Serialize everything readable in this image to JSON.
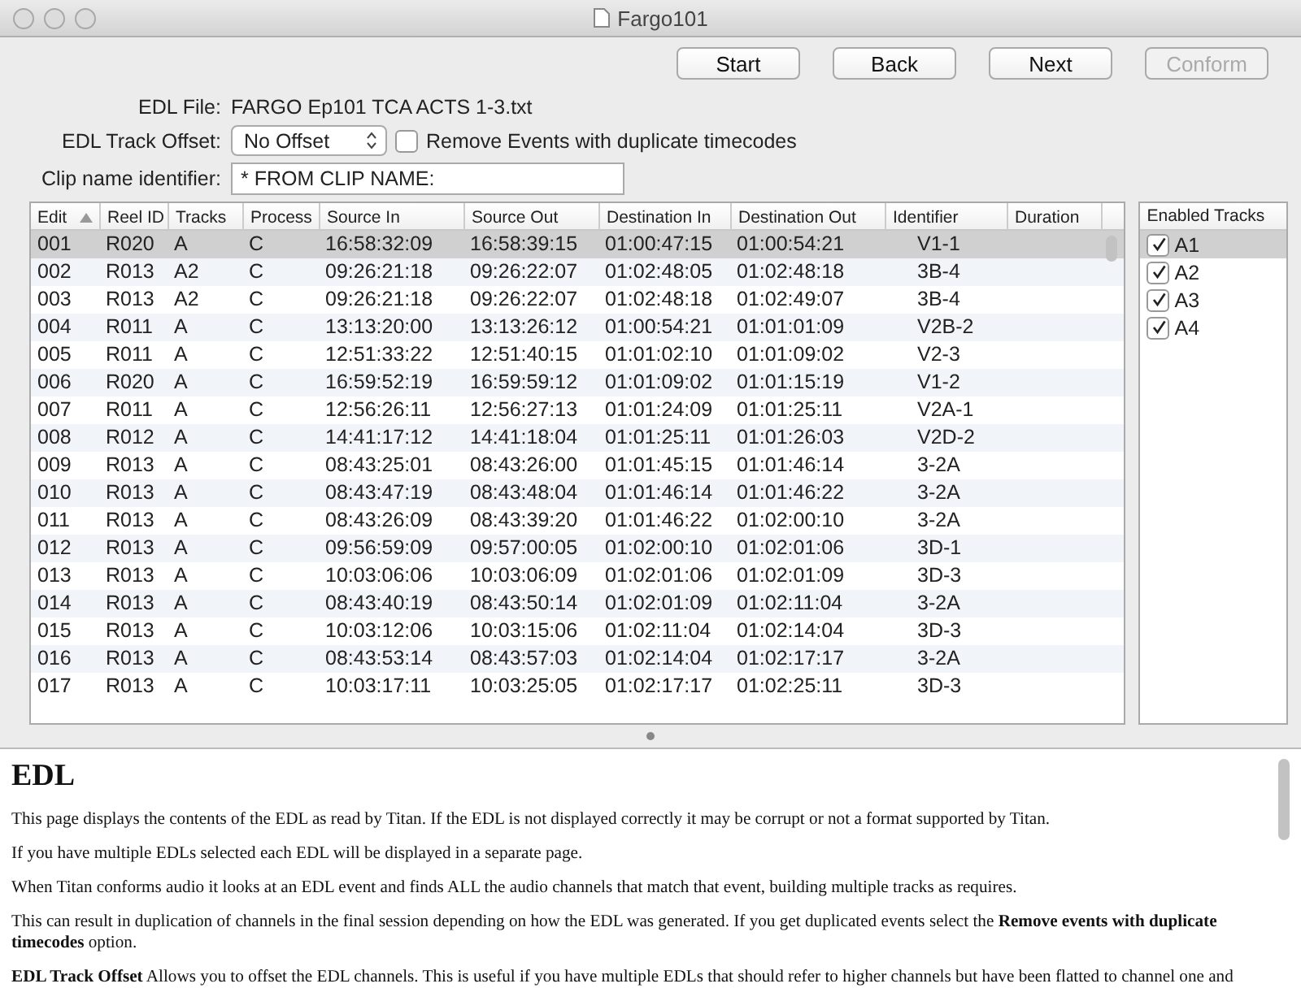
{
  "window": {
    "title": "Fargo101"
  },
  "toolbar": {
    "buttons": [
      {
        "label": "Start",
        "disabled": false
      },
      {
        "label": "Back",
        "disabled": false
      },
      {
        "label": "Next",
        "disabled": false
      },
      {
        "label": "Conform",
        "disabled": true
      }
    ]
  },
  "form": {
    "edl_file": {
      "label": "EDL File:",
      "value": "FARGO Ep101 TCA ACTS 1-3.txt"
    },
    "track_offset": {
      "label": "EDL Track Offset:",
      "value": "No Offset"
    },
    "remove_duplicates": {
      "label": "Remove Events with duplicate timecodes",
      "checked": false
    },
    "clip_name": {
      "label": "Clip name identifier:",
      "value": "* FROM CLIP NAME:"
    }
  },
  "table": {
    "columns": [
      {
        "label": "Edit",
        "sorted": true
      },
      {
        "label": "Reel ID",
        "sorted": false
      },
      {
        "label": "Tracks",
        "sorted": false
      },
      {
        "label": "Process",
        "sorted": false
      },
      {
        "label": "Source In",
        "sorted": false
      },
      {
        "label": "Source Out",
        "sorted": false
      },
      {
        "label": "Destination In",
        "sorted": false
      },
      {
        "label": "Destination Out",
        "sorted": false
      },
      {
        "label": "Identifier",
        "sorted": false
      },
      {
        "label": "Duration",
        "sorted": false
      }
    ],
    "rows": [
      {
        "selected": true,
        "cells": [
          "001",
          "R020",
          "A",
          "C",
          "16:58:32:09",
          "16:58:39:15",
          "01:00:47:15",
          "01:00:54:21",
          "V1-1"
        ]
      },
      {
        "selected": false,
        "cells": [
          "002",
          "R013",
          "A2",
          "C",
          "09:26:21:18",
          "09:26:22:07",
          "01:02:48:05",
          "01:02:48:18",
          "3B-4"
        ]
      },
      {
        "selected": false,
        "cells": [
          "003",
          "R013",
          "A2",
          "C",
          "09:26:21:18",
          "09:26:22:07",
          "01:02:48:18",
          "01:02:49:07",
          "3B-4"
        ]
      },
      {
        "selected": false,
        "cells": [
          "004",
          "R011",
          "A",
          "C",
          "13:13:20:00",
          "13:13:26:12",
          "01:00:54:21",
          "01:01:01:09",
          "V2B-2"
        ]
      },
      {
        "selected": false,
        "cells": [
          "005",
          "R011",
          "A",
          "C",
          "12:51:33:22",
          "12:51:40:15",
          "01:01:02:10",
          "01:01:09:02",
          "V2-3"
        ]
      },
      {
        "selected": false,
        "cells": [
          "006",
          "R020",
          "A",
          "C",
          "16:59:52:19",
          "16:59:59:12",
          "01:01:09:02",
          "01:01:15:19",
          "V1-2"
        ]
      },
      {
        "selected": false,
        "cells": [
          "007",
          "R011",
          "A",
          "C",
          "12:56:26:11",
          "12:56:27:13",
          "01:01:24:09",
          "01:01:25:11",
          "V2A-1"
        ]
      },
      {
        "selected": false,
        "cells": [
          "008",
          "R012",
          "A",
          "C",
          "14:41:17:12",
          "14:41:18:04",
          "01:01:25:11",
          "01:01:26:03",
          "V2D-2"
        ]
      },
      {
        "selected": false,
        "cells": [
          "009",
          "R013",
          "A",
          "C",
          "08:43:25:01",
          "08:43:26:00",
          "01:01:45:15",
          "01:01:46:14",
          "3-2A"
        ]
      },
      {
        "selected": false,
        "cells": [
          "010",
          "R013",
          "A",
          "C",
          "08:43:47:19",
          "08:43:48:04",
          "01:01:46:14",
          "01:01:46:22",
          "3-2A"
        ]
      },
      {
        "selected": false,
        "cells": [
          "011",
          "R013",
          "A",
          "C",
          "08:43:26:09",
          "08:43:39:20",
          "01:01:46:22",
          "01:02:00:10",
          "3-2A"
        ]
      },
      {
        "selected": false,
        "cells": [
          "012",
          "R013",
          "A",
          "C",
          "09:56:59:09",
          "09:57:00:05",
          "01:02:00:10",
          "01:02:01:06",
          "3D-1"
        ]
      },
      {
        "selected": false,
        "cells": [
          "013",
          "R013",
          "A",
          "C",
          "10:03:06:06",
          "10:03:06:09",
          "01:02:01:06",
          "01:02:01:09",
          "3D-3"
        ]
      },
      {
        "selected": false,
        "cells": [
          "014",
          "R013",
          "A",
          "C",
          "08:43:40:19",
          "08:43:50:14",
          "01:02:01:09",
          "01:02:11:04",
          "3-2A"
        ]
      },
      {
        "selected": false,
        "cells": [
          "015",
          "R013",
          "A",
          "C",
          "10:03:12:06",
          "10:03:15:06",
          "01:02:11:04",
          "01:02:14:04",
          "3D-3"
        ]
      },
      {
        "selected": false,
        "cells": [
          "016",
          "R013",
          "A",
          "C",
          "08:43:53:14",
          "08:43:57:03",
          "01:02:14:04",
          "01:02:17:17",
          "3-2A"
        ]
      },
      {
        "selected": false,
        "cells": [
          "017",
          "R013",
          "A",
          "C",
          "10:03:17:11",
          "10:03:25:05",
          "01:02:17:17",
          "01:02:25:11",
          "3D-3"
        ]
      }
    ]
  },
  "enabled_tracks": {
    "title": "Enabled Tracks",
    "items": [
      {
        "label": "A1",
        "checked": true,
        "selected": true
      },
      {
        "label": "A2",
        "checked": true,
        "selected": false
      },
      {
        "label": "A3",
        "checked": true,
        "selected": false
      },
      {
        "label": "A4",
        "checked": true,
        "selected": false
      }
    ]
  },
  "help": {
    "heading": "EDL",
    "paragraphs": [
      "This page displays the contents of the EDL as read by Titan. If the EDL is not displayed correctly it may be corrupt or not a format supported by Titan.",
      "If you have multiple EDLs selected each EDL will be displayed in a separate page.",
      "When Titan conforms audio it looks at an EDL event and finds ALL the audio channels that match that event, building multiple tracks as requires.",
      "This can result in duplication of channels in the final session depending on how the EDL was generated. If you get duplicated events select the **Remove events with duplicate timecodes** option.",
      "**EDL Track Offset** Allows you to offset the EDL channels. This is useful if you have multiple EDLs that should refer to higher channels but have been flatted to channel one and"
    ]
  }
}
